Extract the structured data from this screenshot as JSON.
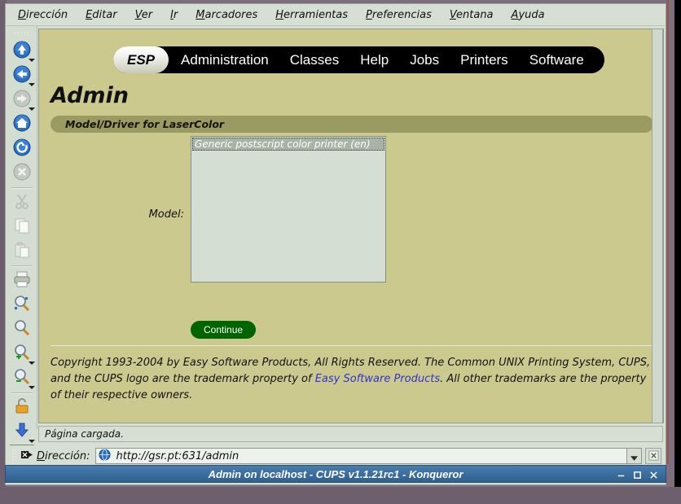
{
  "window": {
    "title": "Admin on localhost - CUPS v1.1.21rc1 - Konqueror",
    "controls": {
      "minimize": "–",
      "maximize": "☐",
      "close": "×"
    }
  },
  "menubar": {
    "items": [
      {
        "name": "direccion",
        "mnemonic": "D",
        "rest": "irección"
      },
      {
        "name": "editar",
        "mnemonic": "E",
        "rest": "ditar"
      },
      {
        "name": "ver",
        "mnemonic": "V",
        "rest": "er"
      },
      {
        "name": "ir",
        "mnemonic": "I",
        "rest": "r"
      },
      {
        "name": "marcadores",
        "mnemonic": "M",
        "rest": "arcadores"
      },
      {
        "name": "herramientas",
        "mnemonic": "H",
        "rest": "erramientas"
      },
      {
        "name": "preferencias",
        "mnemonic": "P",
        "rest": "referencias"
      },
      {
        "name": "ventana",
        "mnemonic": "V",
        "rest": "entana"
      },
      {
        "name": "ayuda",
        "mnemonic": "A",
        "rest": "yuda"
      }
    ]
  },
  "toolbar": {
    "buttons": [
      {
        "icon": "up-arrow-icon",
        "enabled": true,
        "caret": true
      },
      {
        "icon": "back-arrow-icon",
        "enabled": true,
        "caret": true
      },
      {
        "icon": "forward-arrow-icon",
        "enabled": false,
        "caret": true
      },
      {
        "icon": "home-icon",
        "enabled": true,
        "caret": false
      },
      {
        "icon": "reload-icon",
        "enabled": true,
        "caret": false
      },
      {
        "icon": "stop-icon",
        "enabled": false,
        "caret": false
      },
      {
        "icon": "cut-scissors-icon",
        "enabled": false,
        "caret": false
      },
      {
        "icon": "copy-icon",
        "enabled": false,
        "caret": false
      },
      {
        "icon": "paste-icon",
        "enabled": false,
        "caret": false
      },
      {
        "icon": "print-icon",
        "enabled": true,
        "caret": false
      },
      {
        "icon": "find-icon",
        "enabled": true,
        "caret": false
      },
      {
        "icon": "zoom-icon",
        "enabled": true,
        "caret": false
      },
      {
        "icon": "zoom-in-icon",
        "enabled": true,
        "caret": true
      },
      {
        "icon": "zoom-out-icon",
        "enabled": true,
        "caret": true
      },
      {
        "icon": "padlock-icon",
        "enabled": true,
        "caret": false
      },
      {
        "icon": "download-icon",
        "enabled": true,
        "caret": true
      },
      {
        "icon": "gear-icon",
        "enabled": true,
        "caret": false
      }
    ]
  },
  "page": {
    "tabs": [
      {
        "label": "ESP",
        "selected": true
      },
      {
        "label": "Administration",
        "selected": false
      },
      {
        "label": "Classes",
        "selected": false
      },
      {
        "label": "Help",
        "selected": false
      },
      {
        "label": "Jobs",
        "selected": false
      },
      {
        "label": "Printers",
        "selected": false
      },
      {
        "label": "Software",
        "selected": false
      }
    ],
    "title": "Admin",
    "section_heading": "Model/Driver for LaserColor",
    "form": {
      "model_label": "Model:",
      "options": [
        {
          "label": "Generic postscript color printer (en)",
          "selected": true
        }
      ],
      "continue_label": "Continue"
    },
    "copyright": {
      "part1": "Copyright 1993-2004 by Easy Software Products, All Rights Reserved. The Common UNIX Printing System, CUPS, and the CUPS logo are the trademark property of ",
      "link": "Easy Software Products",
      "part2": ". All other trademarks are the property of their respective owners."
    }
  },
  "statusbar": {
    "text": "Página cargada."
  },
  "locationbar": {
    "label_mnemonic": "D",
    "label_rest": "irección:",
    "url": "http://gsr.pt:631/admin",
    "favicon": "globe-icon",
    "dropdown_icon": "chevron-down-icon",
    "clear_icon": "clear-location-icon"
  },
  "colors": {
    "page_background": "#ccc98e",
    "section_bar": "#9a9a63",
    "tab_bar": "#000000",
    "continue_button": "#006400",
    "link": "#3333cc",
    "titlebar": "#3b6f9f",
    "chrome": "#d7dfd4",
    "select_background": "#d5ded2",
    "option_selected": "#a8b3a5"
  }
}
